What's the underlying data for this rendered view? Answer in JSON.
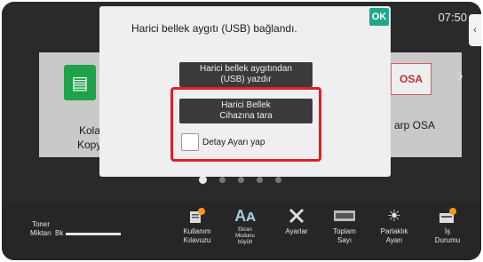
{
  "status": {
    "time": "07:50"
  },
  "home_tiles": {
    "left": {
      "label_line1": "Kolay",
      "label_line2": "Kopya",
      "icon": "copy-icon"
    },
    "right": {
      "label": "arp OSA",
      "logo_text": "OSA",
      "icon": "osa-logo"
    }
  },
  "pager": {
    "count": 5,
    "active": 0
  },
  "dialog": {
    "message": "Harici bellek aygıtı (USB) bağlandı.",
    "ok_label": "OK",
    "print_button": {
      "line1": "Harici bellek aygıtından",
      "line2": "(USB) yazdır"
    },
    "scan_button": {
      "line1": "Harici Bellek",
      "line2": "Cihazına tara"
    },
    "detail_checkbox_label": "Detay Ayarı yap"
  },
  "bottom_bar": {
    "toner_label_line1": "Toner",
    "toner_label_line2": "Miktarı",
    "toner_color": "Bk",
    "items": [
      {
        "line1": "Kullanım",
        "line2": "Kılavuzu",
        "icon": "manual-icon"
      },
      {
        "line1": "Ekran",
        "line2": "Modunu",
        "line3": "büyült",
        "icon": "enlarge-text-icon"
      },
      {
        "line1": "Ayarlar",
        "icon": "settings-icon"
      },
      {
        "line1": "Toplam",
        "line2": "Sayı",
        "icon": "counter-icon"
      },
      {
        "line1": "Parlaklık",
        "line2": "Ayarı",
        "icon": "brightness-icon"
      },
      {
        "line1": "İş",
        "line2": "Durumu",
        "icon": "job-status-icon"
      }
    ]
  },
  "colors": {
    "highlight": "#e0202a",
    "ok": "#20a88a",
    "tile_icon": "#1fa24a"
  }
}
